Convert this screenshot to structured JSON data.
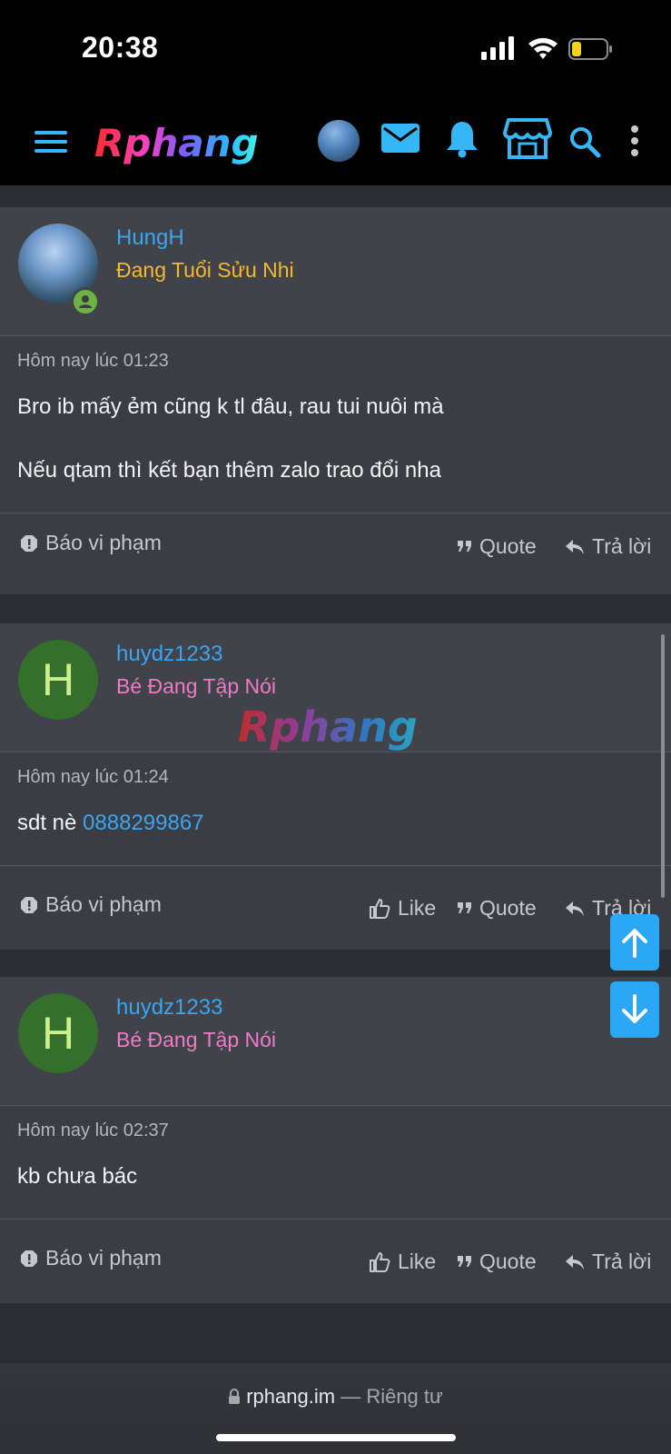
{
  "status": {
    "time": "20:38"
  },
  "nav": {
    "logo_text": "Rphang"
  },
  "posts": [
    {
      "username": "HungH",
      "title": "Đang Tuổi Sửu Nhi",
      "title_color": "#f5b82e",
      "avatar_type": "photo",
      "timestamp": "Hôm nay lúc 01:23",
      "lines": [
        "Bro ib mấy ẻm cũng k tl đâu, rau tui nuôi mà",
        "Nếu qtam thì kết bạn thêm zalo trao đổi nha"
      ],
      "actions": {
        "report": "Báo vi phạm",
        "quote": "Quote",
        "reply": "Trả lời"
      }
    },
    {
      "username": "huydz1233",
      "title": "Bé Đang Tập Nói",
      "title_color": "#f07ac6",
      "avatar_letter": "H",
      "timestamp": "Hôm nay lúc 01:24",
      "message_prefix": "sdt nè ",
      "phone": "0888299867",
      "actions": {
        "report": "Báo vi phạm",
        "like": "Like",
        "quote": "Quote",
        "reply": "Trả lời"
      }
    },
    {
      "username": "huydz1233",
      "title": "Bé Đang Tập Nói",
      "title_color": "#f07ac6",
      "avatar_letter": "H",
      "timestamp": "Hôm nay lúc 02:37",
      "message": "kb chưa bác",
      "actions": {
        "report": "Báo vi phạm",
        "like": "Like",
        "quote": "Quote",
        "reply": "Trả lời"
      }
    }
  ],
  "watermark_text": "Rphang",
  "browser": {
    "domain": "rphang.im",
    "separator": " — ",
    "privacy": "Riêng tư"
  },
  "colors": {
    "accent": "#2aa7f5",
    "link": "#3ba5f0",
    "icon_blue": "#35b6f7"
  }
}
